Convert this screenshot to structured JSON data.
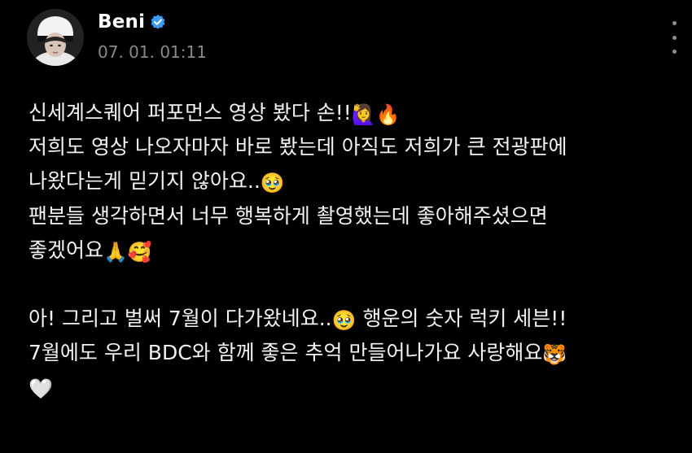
{
  "author": {
    "name": "Beni",
    "timestamp": "07. 01. 01:11"
  },
  "colors": {
    "background": "#000000",
    "text": "#f2f2f2",
    "timestamp": "#8a8a8a",
    "verified_badge": "#3b9cf2"
  },
  "icons": {
    "verified": "verified-badge-icon",
    "menu": "more-vertical-icon"
  },
  "post": {
    "line1": "신세계스퀘어 퍼포먼스 영상 봤다 손!!",
    "line1_emoji1": "🙋‍♀️",
    "line1_emoji2": "🔥",
    "line2": "저희도 영상 나오자마자 바로 봤는데 아직도 저희가 큰 전광판에",
    "line3": "나왔다는게 믿기지 않아요..",
    "line3_emoji": "🥹",
    "line4": "팬분들 생각하면서 너무 행복하게 촬영했는데 좋아해주셨으면",
    "line5": "좋겠어요",
    "line5_emoji1": "🙏",
    "line5_emoji2": "🥰",
    "line6_a": "아! 그리고 벌써 7월이 다가왔네요..",
    "line6_emoji": "🥹",
    "line6_b": " 행운의 숫자 럭키 세븐!!",
    "line7": "7월에도 우리 BDC와 함께 좋은 추억 만들어나가요 사랑해요",
    "line7_emoji": "🐯",
    "line8_emoji": "🤍"
  }
}
